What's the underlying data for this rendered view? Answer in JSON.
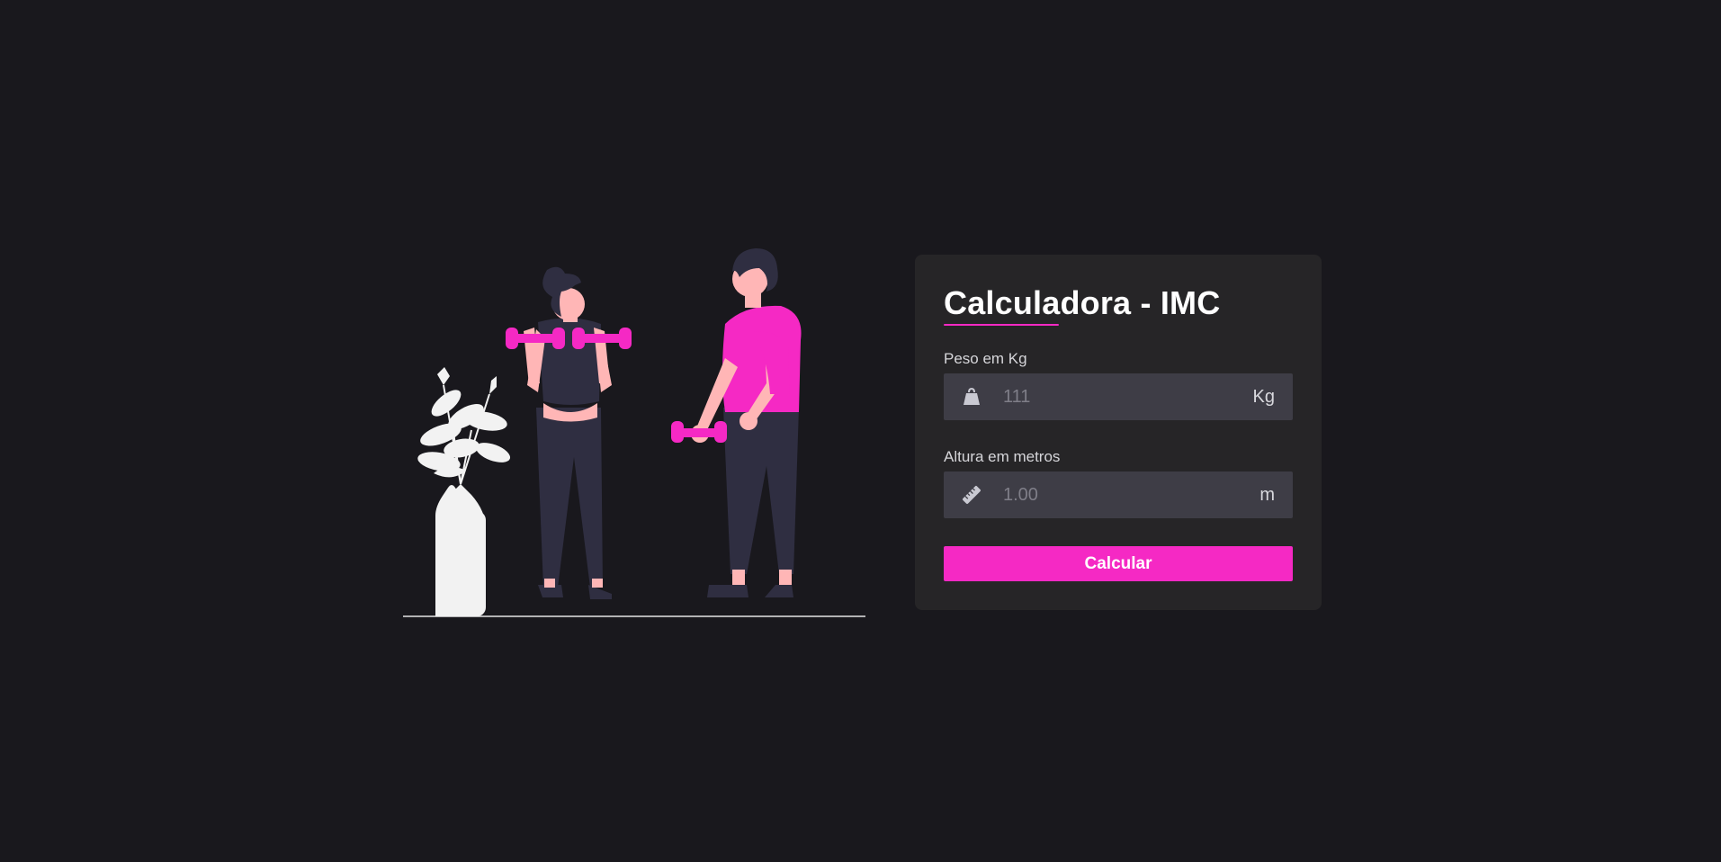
{
  "form": {
    "title": "Calculadora - IMC",
    "weight": {
      "label": "Peso em Kg",
      "value": "",
      "placeholder": "111",
      "unit": "Kg",
      "icon": "weight-icon"
    },
    "height": {
      "label": "Altura em metros",
      "value": "",
      "placeholder": "1.00",
      "unit": "m",
      "icon": "ruler-icon"
    },
    "submit_label": "Calcular"
  },
  "colors": {
    "background": "#19181d",
    "card": "#262527",
    "input": "#3e3d46",
    "accent": "#f529c4",
    "text": "#ffffff"
  }
}
